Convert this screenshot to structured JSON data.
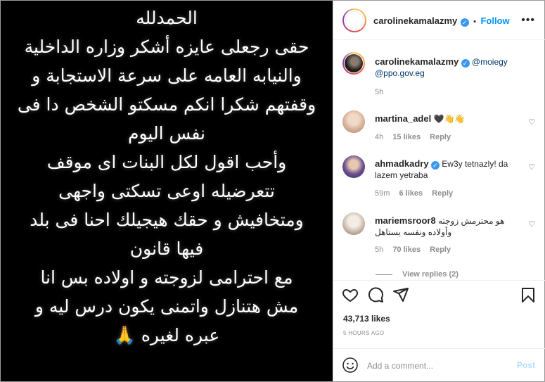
{
  "post": {
    "story_lines": [
      "الحمدلله",
      "حقى رجعلى عايزه أشكر وزاره الداخلية",
      "والنيابه العامه على سرعة الاستجابة و",
      "وقفتهم شكرا انكم مسكتو الشخص دا فى",
      "نفس اليوم",
      "وأحب اقول لكل البنات اى موقف",
      "تتعرضيله اوعى تسكتى واجهى",
      "ومتخافيش و حقك هيجيلك احنا فى بلد",
      "فيها قانون",
      "مع احترامى لزوجته و اولاده بس انا",
      "مش هتنازل واتمنى يكون درس ليه و",
      "عبره لغيره"
    ],
    "closing_emoji": "🙏"
  },
  "header": {
    "username": "carolinekamalazmy",
    "separator": "•",
    "follow_label": "Follow",
    "more_label": "•••"
  },
  "caption": {
    "username": "carolinekamalazmy",
    "mentions": [
      "@moiegy",
      "@ppo.gov.eg"
    ],
    "time": "5h"
  },
  "comments": [
    {
      "username": "martina_adel",
      "text": "🖤👋👋",
      "time": "4h",
      "likes": "15 likes",
      "reply": "Reply",
      "avatar_color": "#d9b39a"
    },
    {
      "username": "ahmadkadry",
      "text": "Ew3y tetnazly! da lazem yetraba",
      "time": "59m",
      "likes": "6 likes",
      "reply": "Reply",
      "avatar_color": "#6b4e8f"
    },
    {
      "username": "mariemsroor8",
      "text": "هو محترمش زوجته وأولاده ونفسه يستاهل",
      "time": "5h",
      "likes": "70 likes",
      "reply": "Reply",
      "avatar_color": "#c9b8a8"
    }
  ],
  "view_replies": "View replies (2)",
  "actions": {
    "likes": "43,713 likes",
    "time": "5 HOURS AGO",
    "comment_placeholder": "Add a comment...",
    "post_label": "Post"
  },
  "colors": {
    "accent": "#0095f6",
    "verified": "#3897f0",
    "post_disabled": "#b2dffc",
    "image_bg": "#000000"
  },
  "icons": [
    "heart-icon",
    "comment-icon",
    "share-icon",
    "bookmark-icon",
    "emoji-icon",
    "verified-badge-icon",
    "more-options-icon"
  ]
}
